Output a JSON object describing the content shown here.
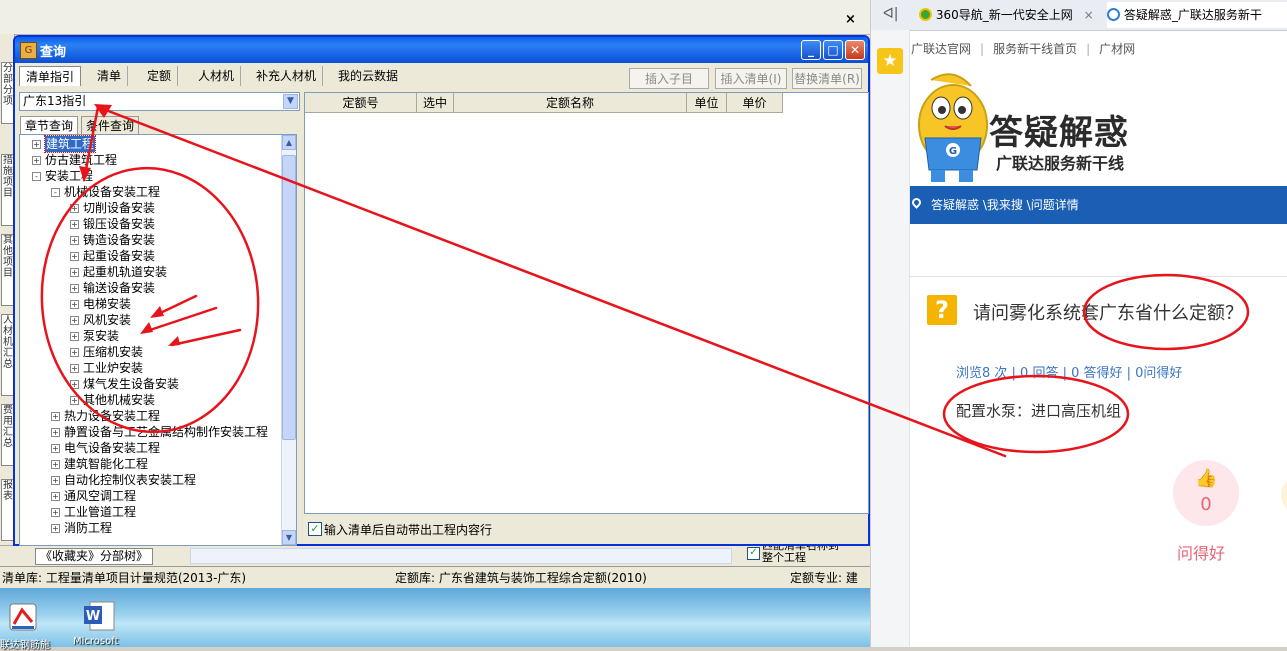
{
  "background_app": {
    "close_glyph": "×",
    "vertical_tabs": [
      "分部分项",
      "措施项目",
      "其他项目",
      "人材机汇总",
      "费用汇总",
      "报表"
    ],
    "bottom_tab": "《收藏夹》分部树》",
    "bottom_checkbox_label": "匹配清单名称到整个工程",
    "status": {
      "list_lib": "清单库:  工程量清单项目计量规范(2013-广东)",
      "quota_lib": "定额库:  广东省建筑与装饰工程综合定额(2010)",
      "quota_major": "定额专业:  建"
    },
    "desktop_icons": [
      {
        "name": "广联达钢筋",
        "label": "联达钢筋施",
        "icon": "glodon-icon"
      },
      {
        "name": "Microsoft Word",
        "label": "Microsoft",
        "icon": "word-icon"
      }
    ]
  },
  "dialog": {
    "title": "查询",
    "caption_buttons": {
      "minimize": "_",
      "maximize": "□",
      "close": "✕"
    },
    "tabs": [
      "清单指引",
      "清单",
      "定额",
      "人材机",
      "补充人材机",
      "我的云数据"
    ],
    "action_buttons": [
      "插入子目",
      "插入清单(I)",
      "替换清单(R)"
    ],
    "combo_value": "广东13指引",
    "sub_tabs": [
      "章节查询",
      "条件查询"
    ],
    "tree": [
      {
        "level": 0,
        "box": "+",
        "label": "建筑工程",
        "selected": true
      },
      {
        "level": 0,
        "box": "+",
        "label": "仿古建筑工程"
      },
      {
        "level": 0,
        "box": "-",
        "label": "安装工程"
      },
      {
        "level": 1,
        "box": "-",
        "label": "机械设备安装工程"
      },
      {
        "level": 2,
        "box": "+",
        "label": "切削设备安装"
      },
      {
        "level": 2,
        "box": "+",
        "label": "锻压设备安装"
      },
      {
        "level": 2,
        "box": "+",
        "label": "铸造设备安装"
      },
      {
        "level": 2,
        "box": "+",
        "label": "起重设备安装"
      },
      {
        "level": 2,
        "box": "+",
        "label": "起重机轨道安装"
      },
      {
        "level": 2,
        "box": "+",
        "label": "输送设备安装"
      },
      {
        "level": 2,
        "box": "+",
        "label": "电梯安装"
      },
      {
        "level": 2,
        "box": "+",
        "label": "风机安装"
      },
      {
        "level": 2,
        "box": "+",
        "label": "泵安装"
      },
      {
        "level": 2,
        "box": "+",
        "label": "压缩机安装"
      },
      {
        "level": 2,
        "box": "+",
        "label": "工业炉安装"
      },
      {
        "level": 2,
        "box": "+",
        "label": "煤气发生设备安装"
      },
      {
        "level": 2,
        "box": "+",
        "label": "其他机械安装"
      },
      {
        "level": 1,
        "box": "+",
        "label": "热力设备安装工程"
      },
      {
        "level": 1,
        "box": "+",
        "label": "静置设备与工艺金属结构制作安装工程"
      },
      {
        "level": 1,
        "box": "+",
        "label": "电气设备安装工程"
      },
      {
        "level": 1,
        "box": "+",
        "label": "建筑智能化工程"
      },
      {
        "level": 1,
        "box": "+",
        "label": "自动化控制仪表安装工程"
      },
      {
        "level": 1,
        "box": "+",
        "label": "通风空调工程"
      },
      {
        "level": 1,
        "box": "+",
        "label": "工业管道工程"
      },
      {
        "level": 1,
        "box": "+",
        "label": "消防工程"
      }
    ],
    "grid_columns": [
      "定额号",
      "选中",
      "定额名称",
      "单位",
      "单价"
    ],
    "auto_checkbox_label": "输入清单后自动带出工程内容行",
    "auto_checkbox_checked": true,
    "scroll_glyphs": {
      "up": "▲",
      "down": "▼",
      "combo": "▼"
    }
  },
  "browser": {
    "back_glyph": "ᐊ|",
    "tabs": [
      {
        "label": "360导航_新一代安全上网",
        "icon": "360-icon",
        "close": "×"
      },
      {
        "label": "答疑解惑_广联达服务新干",
        "icon": "ie-icon",
        "close": "×"
      }
    ],
    "star_glyph": "★",
    "nav_links": [
      "广联达官网",
      "服务新干线首页",
      "广材网"
    ],
    "logo_title": "答疑解惑",
    "logo_subtitle": "广联达服务新干线",
    "breadcrumb": "答疑解惑 \\我来搜 \\问题详情",
    "question_icon": "?",
    "question": "请问雾化系统套广东省什么定额？",
    "stats": "浏览8 次 | 0 回答 | 0 答得好 | 0问得好",
    "answer": "配置水泵：进口高压机组",
    "like_icon": "👍",
    "like_count": "0",
    "like_label": "问得好"
  },
  "colors": {
    "annotation_red": "#e8141c",
    "xp_blue": "#0a4fd6",
    "brand_blue": "#1a5fb4",
    "question_yellow": "#f5b400",
    "like_pink": "#e7657a"
  }
}
